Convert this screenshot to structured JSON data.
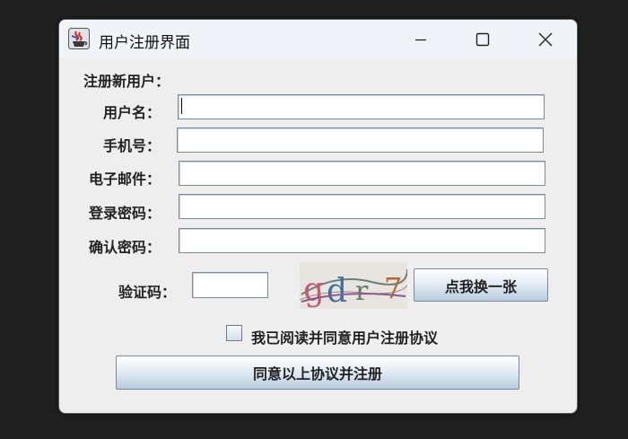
{
  "window": {
    "title": "用户注册界面",
    "icon": "java-coffee-cup-icon"
  },
  "titlebar_controls": {
    "minimize_icon": "minimize-icon",
    "maximize_icon": "maximize-icon",
    "close_icon": "close-icon"
  },
  "form": {
    "heading": "注册新用户：",
    "username": {
      "label": "用户名：",
      "value": ""
    },
    "phone": {
      "label": "手机号：",
      "value": ""
    },
    "email": {
      "label": "电子邮件：",
      "value": ""
    },
    "password": {
      "label": "登录密码：",
      "value": ""
    },
    "confirm_password": {
      "label": "确认密码：",
      "value": ""
    },
    "captcha": {
      "label": "验证码：",
      "value": "",
      "image_text": "gdr7"
    },
    "refresh_captcha_label": "点我换一张",
    "agreement": {
      "label": "我已阅读并同意用户注册协议",
      "checked": false
    },
    "submit_label": "同意以上协议并注册"
  },
  "colors": {
    "window_bg": "#eeeeee",
    "titlebar_bg": "#f0f4f9",
    "desktop_bg": "#202020",
    "button_gradient_bottom": "#b8cbdd"
  }
}
